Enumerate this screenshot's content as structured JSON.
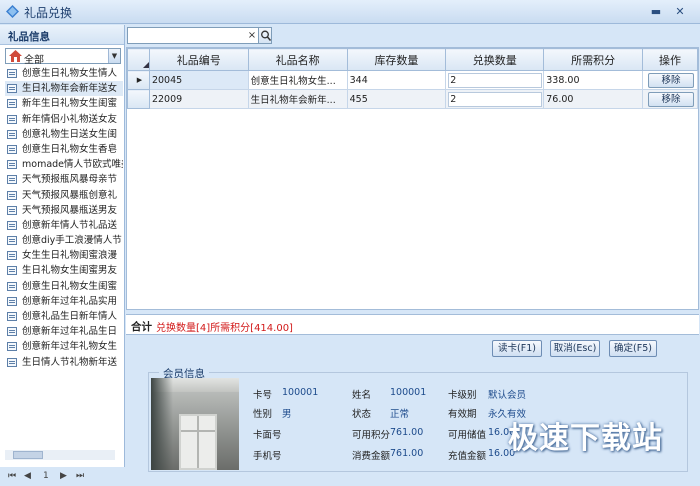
{
  "window": {
    "title": "礼品兑换"
  },
  "sidebar": {
    "header": "礼品信息",
    "category_select": "全部",
    "items": [
      "创意生日礼物女生情人",
      "生日礼物年会新年送女",
      "新年生日礼物女生闺蜜",
      "新年情侣小礼物送女友",
      "创意礼物生日送女生闺",
      "创意生日礼物女生香皂",
      "momade情人节欧式唯美",
      "天气预报瓶风暴母亲节",
      "天气预报风暴瓶创意礼",
      "天气预报风暴瓶送男友",
      "创意新年情人节礼品送",
      "创意diy手工浪漫情人节",
      "女生生日礼物闺蜜浪漫",
      "生日礼物女生闺蜜男友",
      "创意生日礼物女生闺蜜",
      "创意新年过年礼品实用",
      "创意礼品生日新年情人",
      "创意新年过年礼品生日",
      "创意新年过年礼物女生",
      "生日情人节礼物新年送"
    ],
    "pager": {
      "page": "1"
    }
  },
  "search": {
    "value": "",
    "clear_icon": "×"
  },
  "grid": {
    "columns": [
      "礼品编号",
      "礼品名称",
      "库存数量",
      "兑换数量",
      "所需积分",
      "操作"
    ],
    "rows": [
      {
        "code": "20045",
        "name": "创意生日礼物女生...",
        "stock": "344",
        "qty": "2",
        "points": "338.00",
        "action": "移除"
      },
      {
        "code": "22009",
        "name": "生日礼物年会新年...",
        "stock": "455",
        "qty": "2",
        "points": "76.00",
        "action": "移除"
      }
    ]
  },
  "summary": {
    "label": "合计",
    "value": "兑换数量[4]所需积分[414.00]"
  },
  "buttons": {
    "read_card": "读卡(F1)",
    "cancel": "取消(Esc)",
    "confirm": "确定(F5)"
  },
  "member": {
    "legend": "会员信息",
    "card_no_label": "卡号",
    "card_no": "100001",
    "name_label": "姓名",
    "name": "100001",
    "level_label": "卡级别",
    "level": "默认会员",
    "gender_label": "性别",
    "gender": "男",
    "status_label": "状态",
    "status": "正常",
    "validity_label": "有效期",
    "validity": "永久有效",
    "face_no_label": "卡面号",
    "face_no": "",
    "points_label": "可用积分",
    "points": "761.00",
    "stored_label": "可用储值",
    "stored": "16.00",
    "phone_label": "手机号",
    "phone": "",
    "spent_label": "消费金额",
    "spent": "761.00",
    "recharge_label": "充值金额",
    "recharge": "16.00"
  },
  "watermark": "极速下载站",
  "colors": {
    "accent": "#1d4b8c",
    "summary_red": "#d21a1a",
    "window_bg": "#d6e6f7"
  }
}
